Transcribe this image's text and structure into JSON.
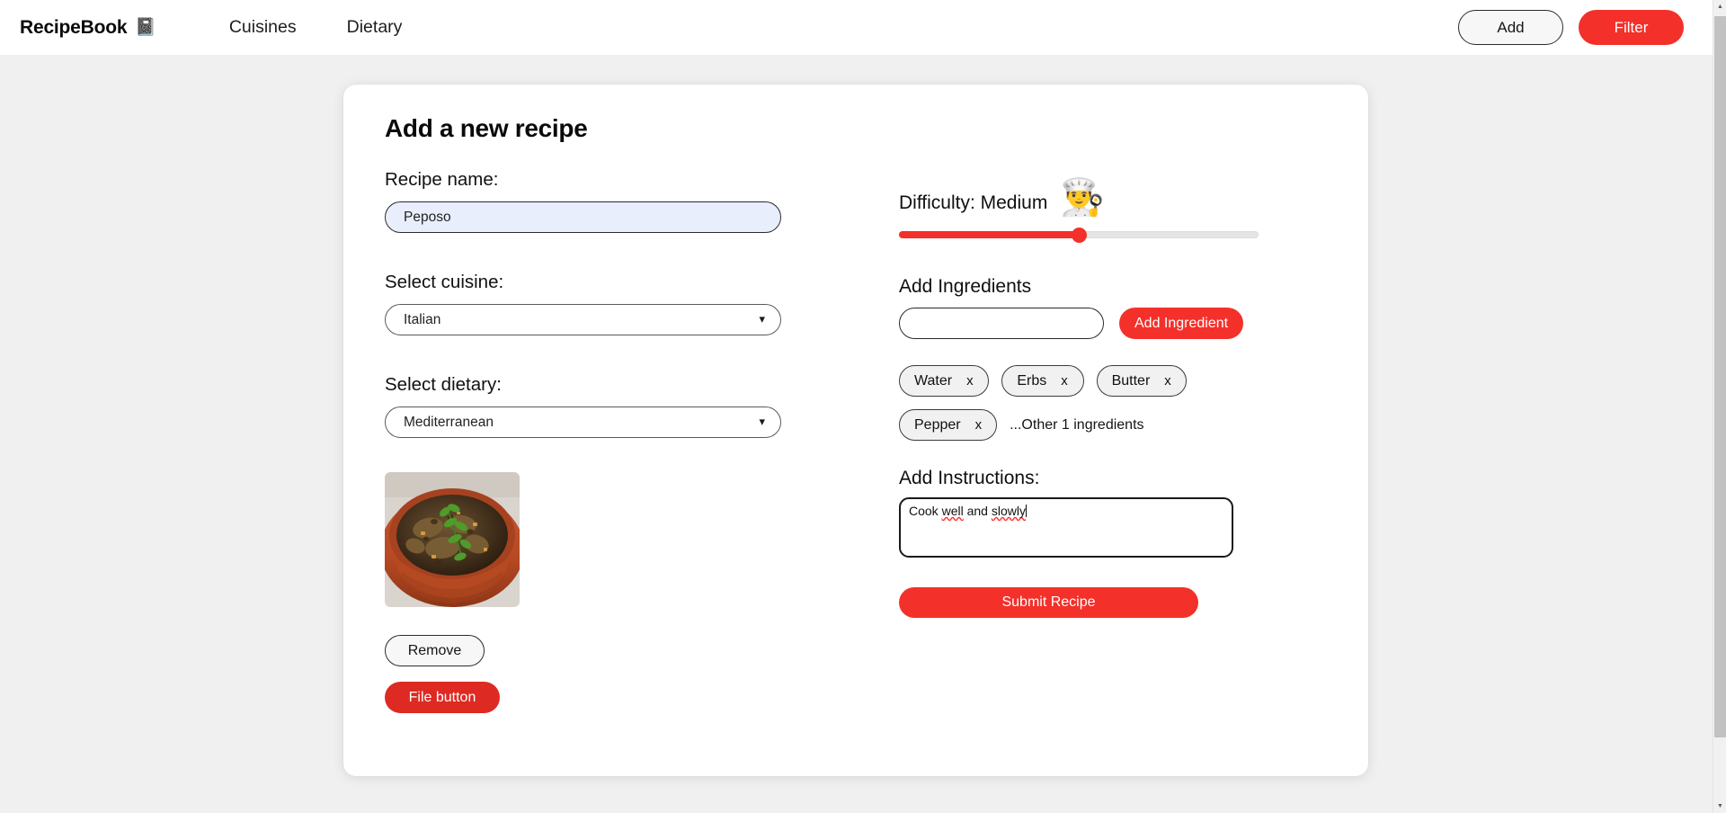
{
  "navbar": {
    "brand": "RecipeBook",
    "brand_icon": "notebook-icon",
    "brand_icon_glyph": "📓",
    "links": [
      {
        "label": "Cuisines"
      },
      {
        "label": "Dietary"
      }
    ],
    "add_button": "Add",
    "filter_button": "Filter"
  },
  "card": {
    "title": "Add a new recipe"
  },
  "recipe_name": {
    "label": "Recipe name:",
    "value": "Peposo",
    "placeholder": ""
  },
  "cuisine": {
    "label": "Select cuisine:",
    "selected": "Italian",
    "options": [
      "Italian"
    ]
  },
  "dietary": {
    "label": "Select dietary:",
    "selected": "Mediterranean",
    "options": [
      "Mediterranean"
    ]
  },
  "image": {
    "alt": "recipe-thumbnail-peposo",
    "remove_button": "Remove",
    "file_button": "File button"
  },
  "difficulty": {
    "label": "Difficulty: Medium",
    "value_label": "Medium",
    "icon": "person-cooking-icon",
    "icon_glyph": "👨‍🍳",
    "percent": 50
  },
  "ingredients": {
    "title": "Add Ingredients",
    "input_value": "",
    "input_placeholder": "",
    "add_button": "Add Ingredient",
    "chips": [
      {
        "name": "Water",
        "remove": "x"
      },
      {
        "name": "Erbs",
        "remove": "x"
      },
      {
        "name": "Butter",
        "remove": "x"
      },
      {
        "name": "Pepper",
        "remove": "x"
      }
    ],
    "more_text": "...Other 1 ingredients"
  },
  "instructions": {
    "title": "Add Instructions:",
    "value": "Cook well and slowly",
    "tokens": [
      {
        "text": "Cook ",
        "misspelled": false
      },
      {
        "text": "well",
        "misspelled": true
      },
      {
        "text": " and ",
        "misspelled": false
      },
      {
        "text": "slowly",
        "misspelled": true
      }
    ]
  },
  "submit": {
    "label": "Submit Recipe"
  },
  "scrollbar": {
    "up_arrow": "▲",
    "down_arrow": "▼"
  },
  "colors": {
    "accent_red": "#f4302a",
    "file_button_red": "#dd2a22",
    "page_bg": "#f0f0f0",
    "card_bg": "#ffffff",
    "input_autofill_bg": "#e8eefb"
  }
}
